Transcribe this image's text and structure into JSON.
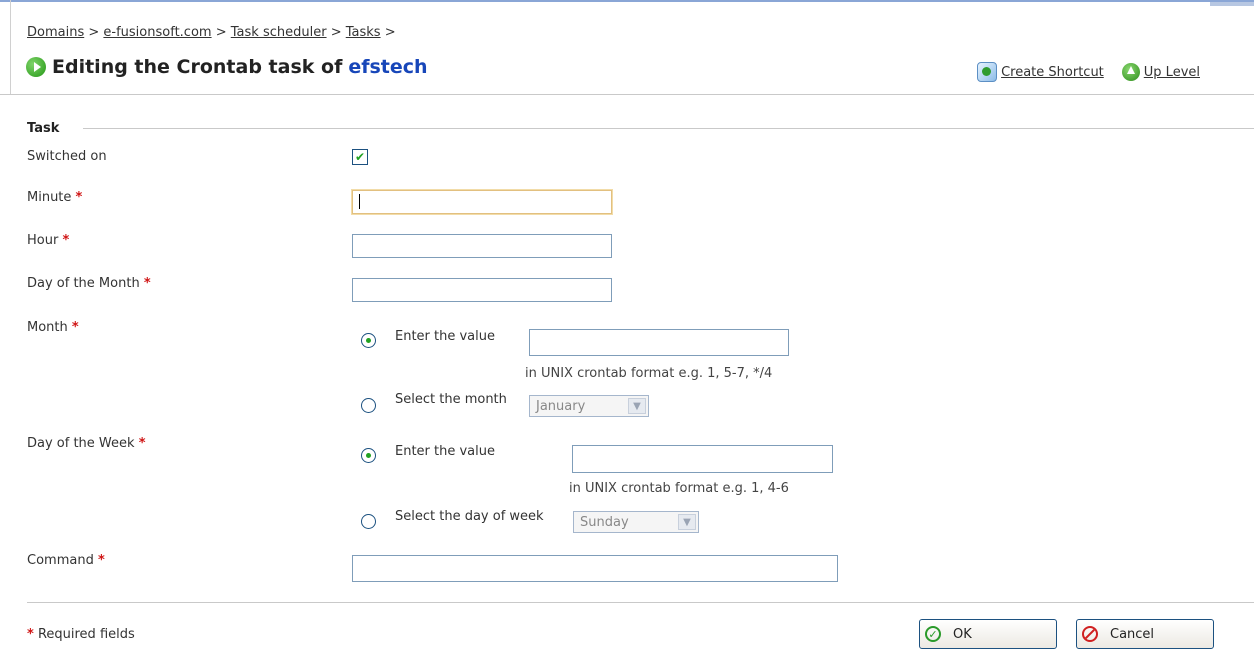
{
  "breadcrumb": {
    "items": [
      {
        "label": "Domains"
      },
      {
        "label": "e-fusionsoft.com"
      },
      {
        "label": "Task scheduler"
      },
      {
        "label": "Tasks"
      }
    ],
    "separator": ">"
  },
  "title": {
    "prefix": "Editing the Crontab task of",
    "name": "efstech"
  },
  "toolbar": {
    "create_shortcut": "Create Shortcut",
    "up_level": "Up Level"
  },
  "form": {
    "section_title": "Task",
    "switched_on_label": "Switched on",
    "switched_on_checked": true,
    "required_mark": "*",
    "minute_label": "Minute",
    "minute_value": "",
    "hour_label": "Hour",
    "hour_value": "",
    "dom_label": "Day of the Month",
    "dom_value": "",
    "month": {
      "label": "Month",
      "enter_value_label": "Enter the value",
      "value": "",
      "hint": "in UNIX crontab format e.g. 1, 5-7, */4",
      "select_label": "Select the month",
      "selected_month": "January",
      "mode": "enter"
    },
    "dow": {
      "label": "Day of the Week",
      "enter_value_label": "Enter the value",
      "value": "",
      "hint": "in UNIX crontab format e.g. 1, 4-6",
      "select_label": "Select the day of week",
      "selected_day": "Sunday",
      "mode": "enter"
    },
    "command_label": "Command",
    "command_value": ""
  },
  "footer": {
    "required_note": "Required fields",
    "ok_label": "OK",
    "cancel_label": "Cancel"
  },
  "colors": {
    "required": "#d01515",
    "title_name": "#1746b9",
    "accent_green": "#21a121"
  }
}
